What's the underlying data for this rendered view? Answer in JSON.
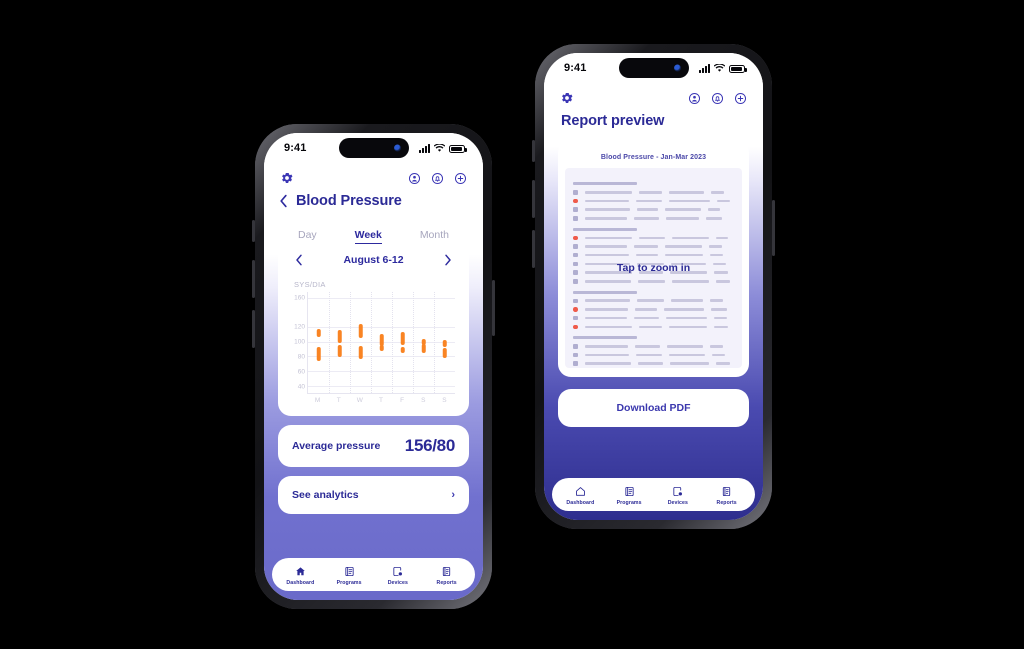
{
  "statusbar": {
    "time": "9:41"
  },
  "topbar": {
    "settings_icon": "gear-icon",
    "icons": [
      "profile-circle-icon",
      "notification-bell-circle-icon",
      "add-plus-circle-icon"
    ]
  },
  "left_phone": {
    "title": "Blood Pressure",
    "back_icon": "chevron-left-icon",
    "tabs": [
      {
        "label": "Day",
        "active": false
      },
      {
        "label": "Week",
        "active": true
      },
      {
        "label": "Month",
        "active": false
      }
    ],
    "date_range": {
      "label": "August 6-12",
      "prev_icon": "chevron-left-icon",
      "next_icon": "chevron-right-icon"
    },
    "chart_data": {
      "type": "bar",
      "title": "",
      "ylabel": "SYS/DIA",
      "xlabel": "",
      "categories": [
        "M",
        "T",
        "W",
        "T",
        "F",
        "S",
        "S"
      ],
      "ytick_labels": [
        "160",
        "120",
        "100",
        "80",
        "60",
        "40"
      ],
      "ytick_values": [
        160,
        120,
        100,
        80,
        60,
        40
      ],
      "ylim": [
        30,
        168
      ],
      "grid": true,
      "series": [
        {
          "name": "SYS",
          "ranges": [
            [
              106,
              118
            ],
            [
              98,
              116
            ],
            [
              105,
              124
            ],
            [
              94,
              111
            ],
            [
              96,
              114
            ],
            [
              96,
              104
            ],
            [
              93,
              102
            ]
          ]
        },
        {
          "name": "DIA",
          "ranges": [
            [
              74,
              93
            ],
            [
              79,
              96
            ],
            [
              77,
              94
            ],
            [
              87,
              96
            ],
            [
              85,
              93
            ],
            [
              85,
              97
            ],
            [
              78,
              92
            ]
          ]
        }
      ],
      "bar_color": "#f98423"
    },
    "average": {
      "label": "Average pressure",
      "value": "156/80"
    },
    "analytics": {
      "label": "See analytics",
      "chevron": "chevron-right-icon"
    },
    "nav": [
      {
        "label": "Dashboard",
        "icon": "home-icon",
        "active": true
      },
      {
        "label": "Programs",
        "icon": "list-card-icon",
        "active": false
      },
      {
        "label": "Devices",
        "icon": "device-check-icon",
        "active": false
      },
      {
        "label": "Reports",
        "icon": "document-icon",
        "active": false
      }
    ]
  },
  "right_phone": {
    "title": "Report preview",
    "document": {
      "header": "Blood Pressure - Jan-Mar 2023",
      "tap_hint": "Tap to zoom in"
    },
    "download_button": "Download PDF",
    "nav": [
      {
        "label": "Dashboard",
        "icon": "home-outline-icon",
        "active": false
      },
      {
        "label": "Programs",
        "icon": "list-card-icon",
        "active": false
      },
      {
        "label": "Devices",
        "icon": "device-check-icon",
        "active": false
      },
      {
        "label": "Reports",
        "icon": "document-icon",
        "active": false
      }
    ]
  },
  "colors": {
    "brand_indigo": "#2b2a96",
    "accent_orange": "#f98423",
    "left_bg": "#7171cf",
    "right_bg": "#2e2e8e",
    "card_white": "#ffffff"
  }
}
